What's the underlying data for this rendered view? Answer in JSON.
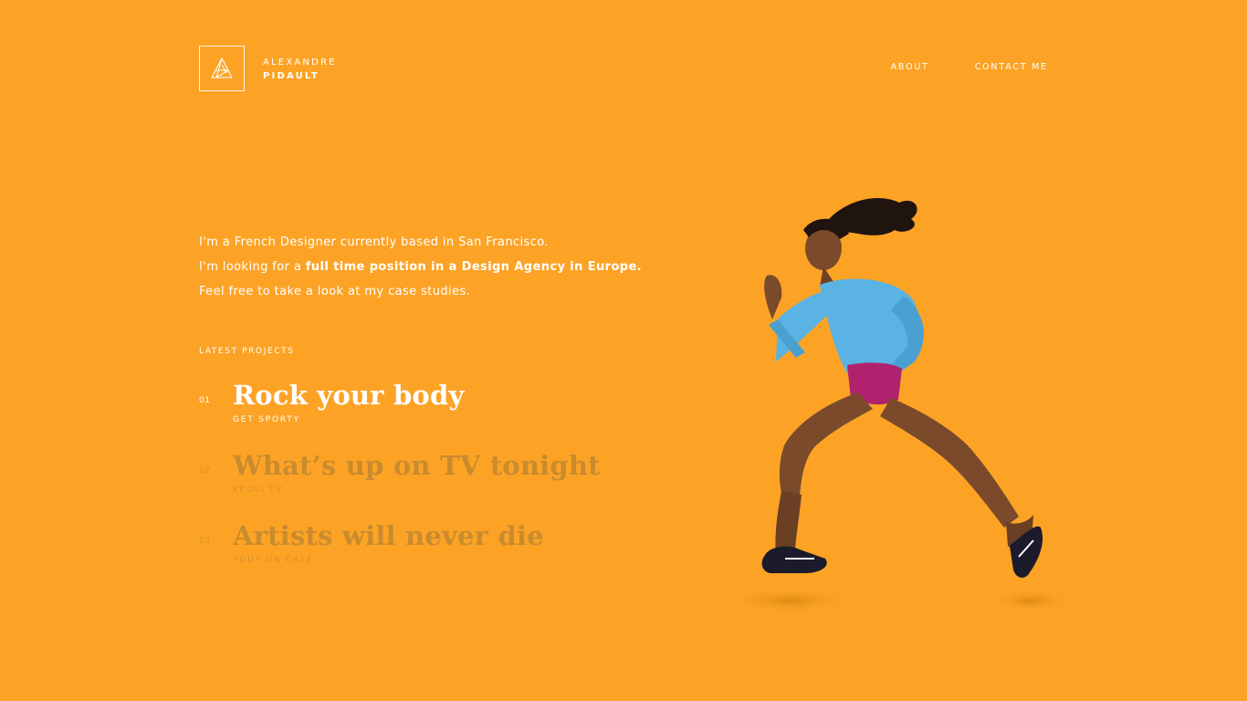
{
  "header": {
    "brand_first": "ALEXANDRE",
    "brand_last": "PIDAULT",
    "logo_icon": "triangle-logo-icon"
  },
  "nav": {
    "about": "ABOUT",
    "contact": "CONTACT ME"
  },
  "intro": {
    "line1": "I'm a French Designer currently based in San Francisco.",
    "line2_prefix": "I'm looking for a ",
    "line2_bold": "full time position in a Design Agency in Europe.",
    "line3": "Feel free to take a look at my case studies."
  },
  "latest_label": "LATEST PROJECTS",
  "projects": [
    {
      "num": "01",
      "title": "Rock your body",
      "subtitle": "GET SPORTY",
      "active": true
    },
    {
      "num": "02",
      "title": "What’s up on TV tonight",
      "subtitle": "KEOLI TV",
      "active": false
    },
    {
      "num": "03",
      "title": "Artists will never die",
      "subtitle": "TOUT UN CAFÉ",
      "active": false
    }
  ],
  "hero": {
    "image": "runner-athlete-illustration"
  },
  "colors": {
    "background": "#fca326",
    "text": "#ffffff",
    "dim_text": "#c98b2d",
    "shirt": "#5ab3e3",
    "shorts": "#b0226e"
  }
}
